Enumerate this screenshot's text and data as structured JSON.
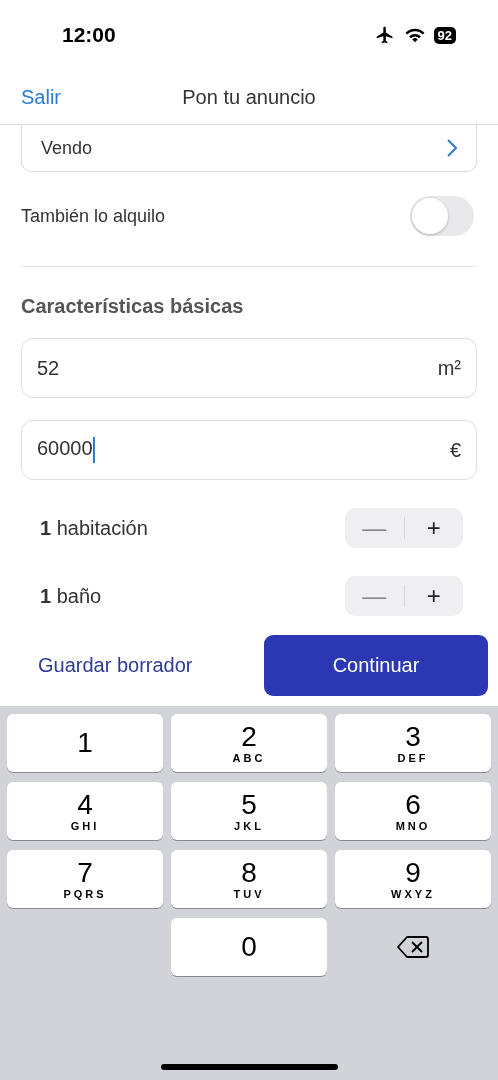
{
  "status_bar": {
    "time": "12:00",
    "battery": "92"
  },
  "nav": {
    "back": "Salir",
    "title": "Pon tu anuncio"
  },
  "transaction": {
    "value": "Vendo"
  },
  "rent_toggle": {
    "label": "También lo alquilo",
    "on": false
  },
  "section_title": "Características básicas",
  "fields": [
    {
      "value": "52",
      "unit": "m²",
      "focused": false
    },
    {
      "value": "60000",
      "unit": "€",
      "focused": true
    }
  ],
  "steppers": [
    {
      "label": "**1** habitación",
      "minus": "—",
      "plus": "+"
    },
    {
      "label": "**1** baño",
      "minus": "—",
      "plus": "+"
    }
  ],
  "actions": {
    "draft": "Guardar borrador",
    "continue": "Continuar"
  },
  "keyboard": {
    "keys": [
      {
        "digit": "1"
      },
      {
        "digit": "2",
        "letters": "ABC"
      },
      {
        "digit": "3",
        "letters": "DEF"
      },
      {
        "digit": "4",
        "letters": "GHI"
      },
      {
        "digit": "5",
        "letters": "JKL"
      },
      {
        "digit": "6",
        "letters": "MNO"
      },
      {
        "digit": "7",
        "letters": "PQRS"
      },
      {
        "digit": "8",
        "letters": "TUV"
      },
      {
        "digit": "9",
        "letters": "WXYZ"
      },
      {
        "digit": "0"
      }
    ]
  }
}
